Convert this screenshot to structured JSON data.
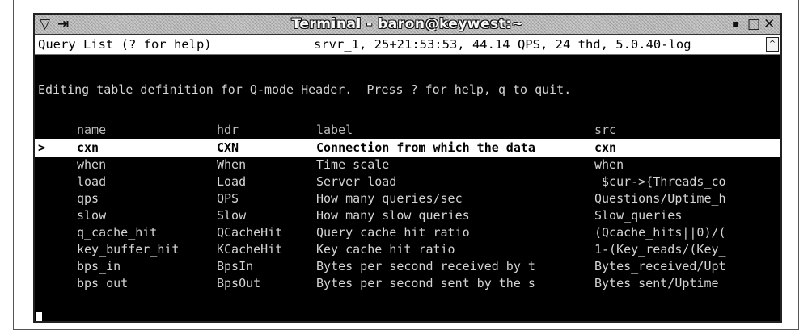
{
  "window": {
    "title": "Terminal - baron@keywest:~",
    "menu_icon": "▽",
    "pin_icon": "⇥",
    "minimize": "▪",
    "maximize": "□",
    "close": "✕"
  },
  "status": {
    "left": "Query List (? for help)",
    "right": "srvr_1, 25+21:53:53, 44.14 QPS, 24 thd, 5.0.40-log",
    "scroll_arrow": "^"
  },
  "editing_message": "Editing table definition for Q-mode Header.  Press ? for help, q to quit.",
  "table": {
    "columns": [
      "name",
      "hdr",
      "label",
      "src"
    ],
    "selected_marker": ">",
    "rows": [
      {
        "name": "cxn",
        "hdr": "CXN",
        "label": "Connection from which the data",
        "src": "cxn",
        "selected": true
      },
      {
        "name": "when",
        "hdr": "When",
        "label": "Time scale",
        "src": "when"
      },
      {
        "name": "load",
        "hdr": "Load",
        "label": "Server load",
        "src": " $cur->{Threads_co"
      },
      {
        "name": "qps",
        "hdr": "QPS",
        "label": "How many queries/sec",
        "src": "Questions/Uptime_h"
      },
      {
        "name": "slow",
        "hdr": "Slow",
        "label": "How many slow queries",
        "src": "Slow_queries"
      },
      {
        "name": "q_cache_hit",
        "hdr": "QCacheHit",
        "label": "Query cache hit ratio",
        "src": "(Qcache_hits||0)/("
      },
      {
        "name": "key_buffer_hit",
        "hdr": "KCacheHit",
        "label": "Key cache hit ratio",
        "src": "1-(Key_reads/(Key_"
      },
      {
        "name": "bps_in",
        "hdr": "BpsIn",
        "label": "Bytes per second received by t",
        "src": "Bytes_received/Upt"
      },
      {
        "name": "bps_out",
        "hdr": "BpsOut",
        "label": "Bytes per second sent by the s",
        "src": "Bytes_sent/Uptime_"
      }
    ]
  }
}
